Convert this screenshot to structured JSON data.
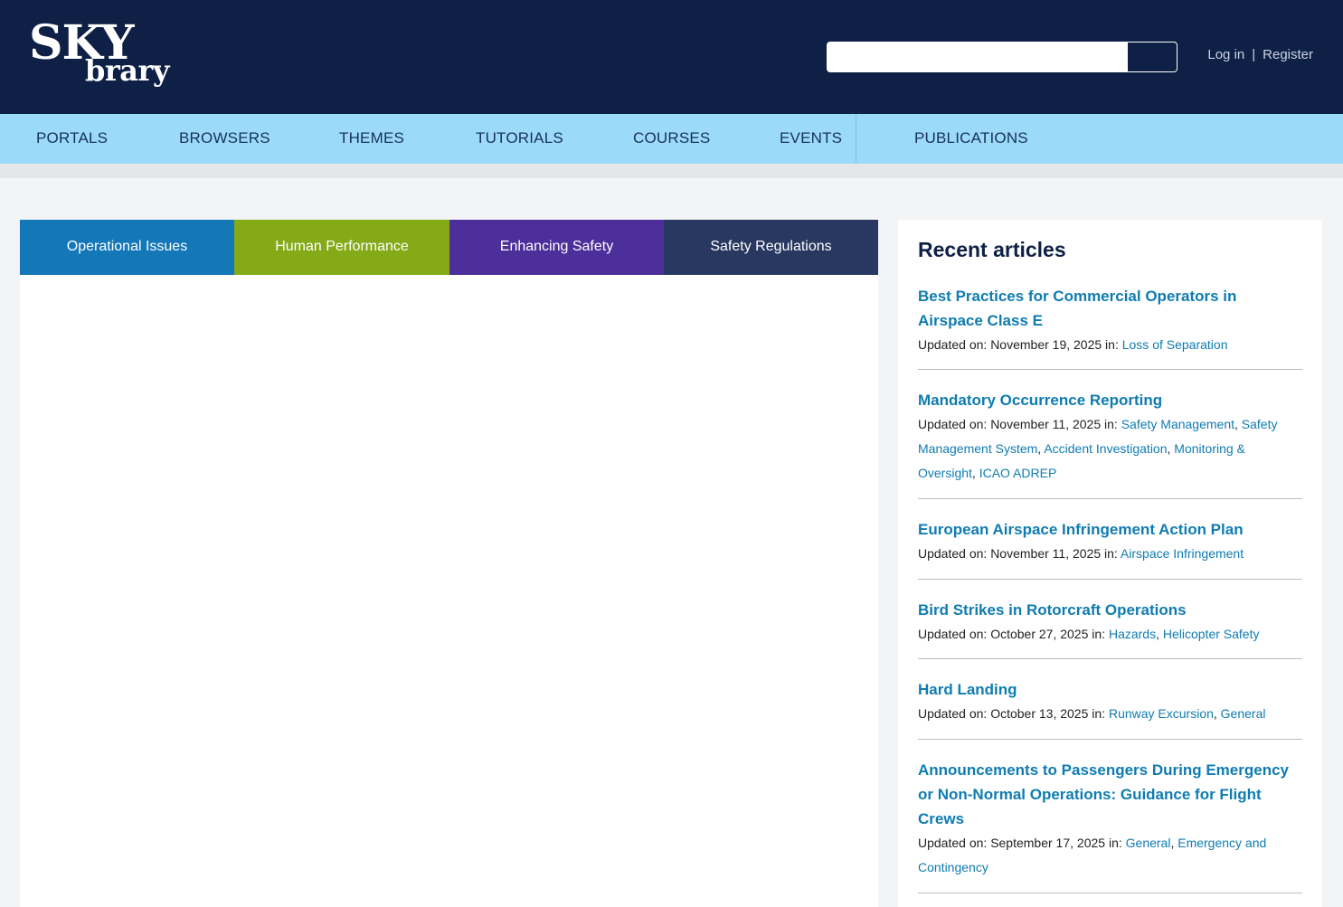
{
  "header": {
    "logo_top": "SKY",
    "logo_bottom": "brary",
    "search": {
      "value": "",
      "placeholder": ""
    },
    "auth": {
      "login": "Log in",
      "separator": "|",
      "register": "Register"
    }
  },
  "nav": {
    "items": [
      "PORTALS",
      "BROWSERS",
      "THEMES",
      "TUTORIALS",
      "COURSES",
      "EVENTS",
      "PUBLICATIONS"
    ]
  },
  "tabs": [
    {
      "label": "Operational Issues",
      "color": "#1477b8"
    },
    {
      "label": "Human Performance",
      "color": "#84aa18"
    },
    {
      "label": "Enhancing Safety",
      "color": "#4c2f9a"
    },
    {
      "label": "Safety Regulations",
      "color": "#283860"
    }
  ],
  "sidebar": {
    "heading": "Recent articles",
    "meta_prefix": "Updated on:",
    "articles": [
      {
        "title": "Best Practices for Commercial Operators in Airspace Class E",
        "date": "November 19, 2025",
        "tags": [
          "Loss of Separation"
        ]
      },
      {
        "title": "Mandatory Occurrence Reporting",
        "date": "November 11, 2025",
        "tags": [
          "Safety Management",
          "Safety Management System",
          "Accident Investigation",
          "Monitoring & Oversight",
          "ICAO ADREP"
        ]
      },
      {
        "title": "European Airspace Infringement Action Plan",
        "date": "November 11, 2025",
        "tags": [
          "Airspace Infringement"
        ]
      },
      {
        "title": "Bird Strikes in Rotorcraft Operations",
        "date": "October 27, 2025",
        "tags": [
          "Hazards",
          "Helicopter Safety"
        ]
      },
      {
        "title": "Hard Landing",
        "date": "October 13, 2025",
        "tags": [
          "Runway Excursion",
          "General"
        ]
      },
      {
        "title": "Announcements to Passengers During Emergency or Non-Normal Operations: Guidance for Flight Crews",
        "date": "September 17, 2025",
        "tags": [
          "General",
          "Emergency and Contingency"
        ]
      }
    ]
  }
}
